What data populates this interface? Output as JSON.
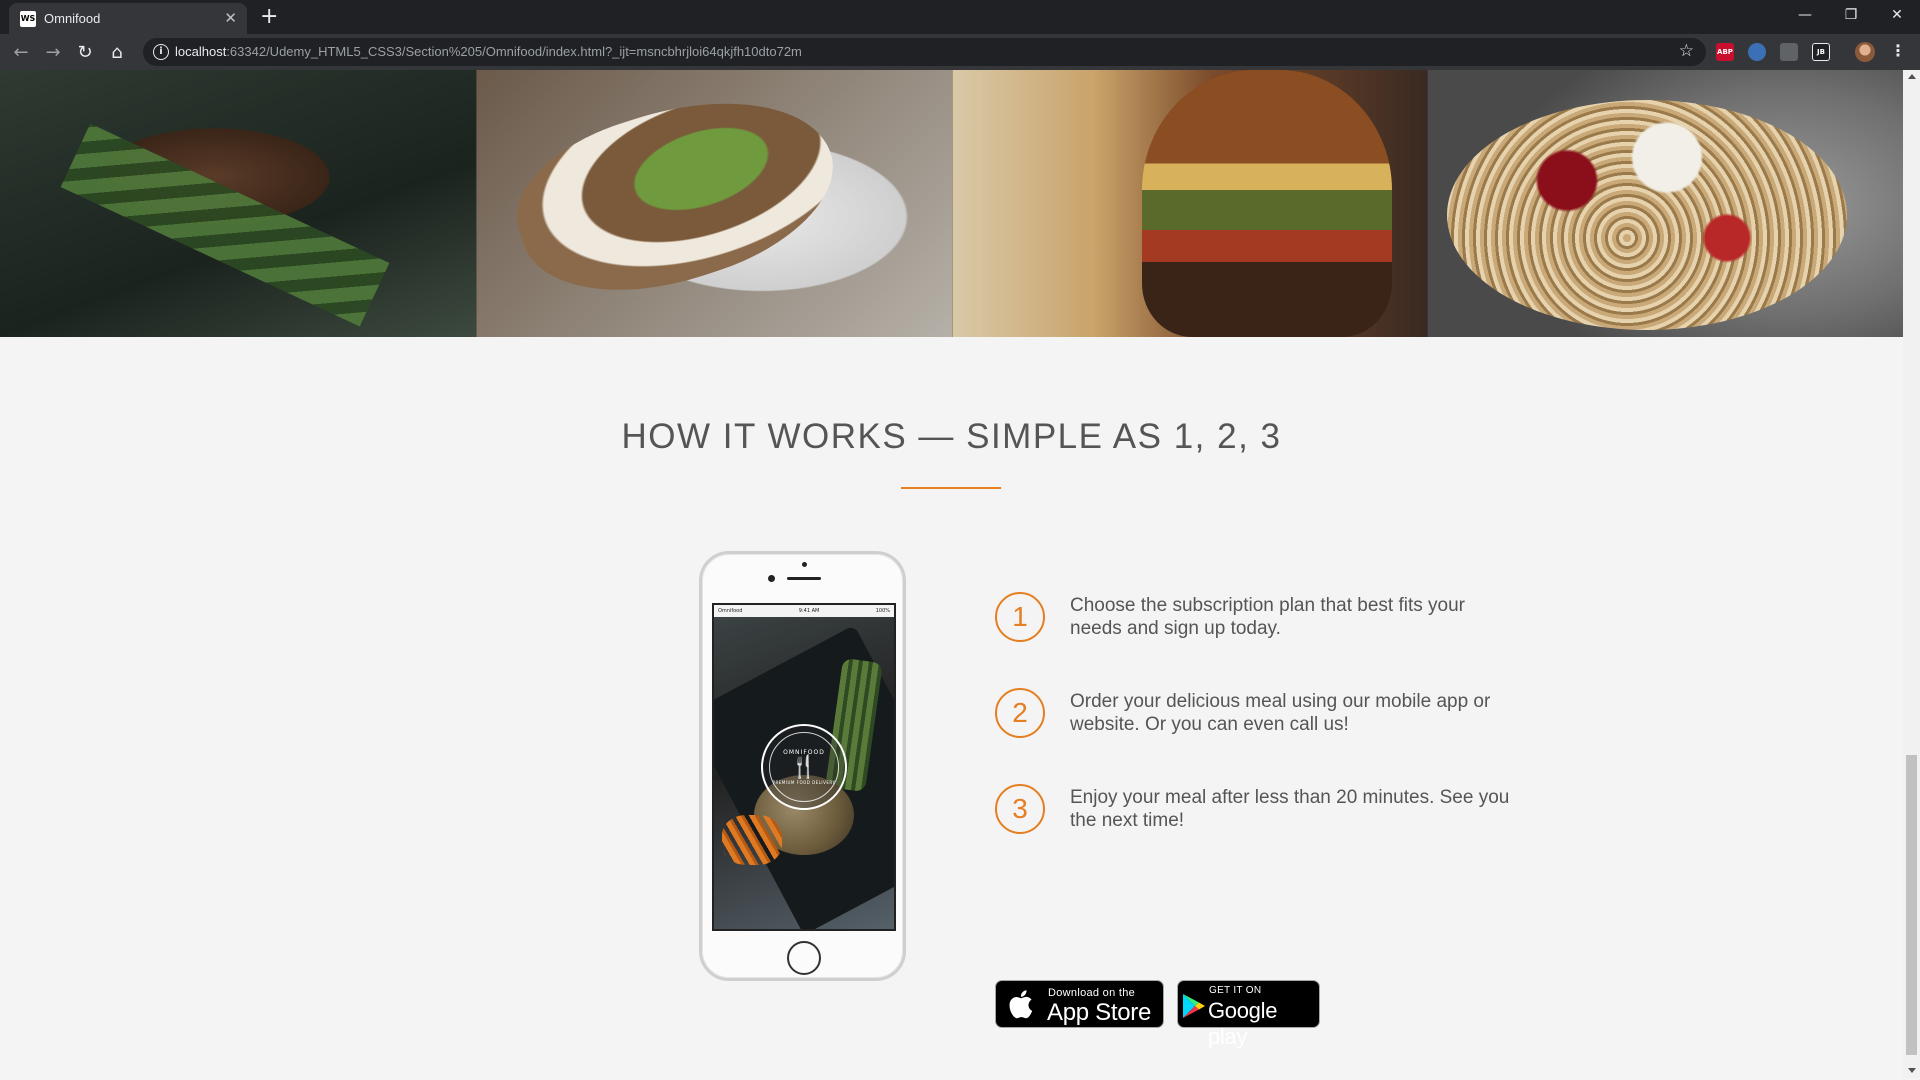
{
  "browser": {
    "tab_title": "Omnifood",
    "tab_favicon_text": "WS",
    "url_host": "localhost",
    "url_rest": ":63342/Udemy_HTML5_CSS3/Section%205/Omnifood/index.html?_ijt=msncbhrjloi64qkjfh10dto72m",
    "extensions": [
      "ABP",
      "JB"
    ]
  },
  "section": {
    "title": "HOW IT WORKS — SIMPLE AS 1, 2, 3"
  },
  "phone": {
    "status_left": "Omnifood",
    "status_center": "9:41 AM",
    "status_right": "100%",
    "logo_top": "OMNIFOOD",
    "logo_bottom": "PREMIUM FOOD DELIVERY"
  },
  "steps": [
    {
      "number": "1",
      "text": "Choose the subscription plan that best fits your needs and sign up today."
    },
    {
      "number": "2",
      "text": "Order your delicious meal using our mobile app or website. Or you can even call us!"
    },
    {
      "number": "3",
      "text": "Enjoy your meal after less than 20 minutes. See you the next time!"
    }
  ],
  "badges": {
    "apple_small": "Download on the",
    "apple_big": "App Store",
    "google_small": "GET IT ON",
    "google_big": "Google play"
  },
  "colors": {
    "accent": "#e67e22",
    "text": "#555555",
    "page_bg": "#f4f4f4"
  }
}
